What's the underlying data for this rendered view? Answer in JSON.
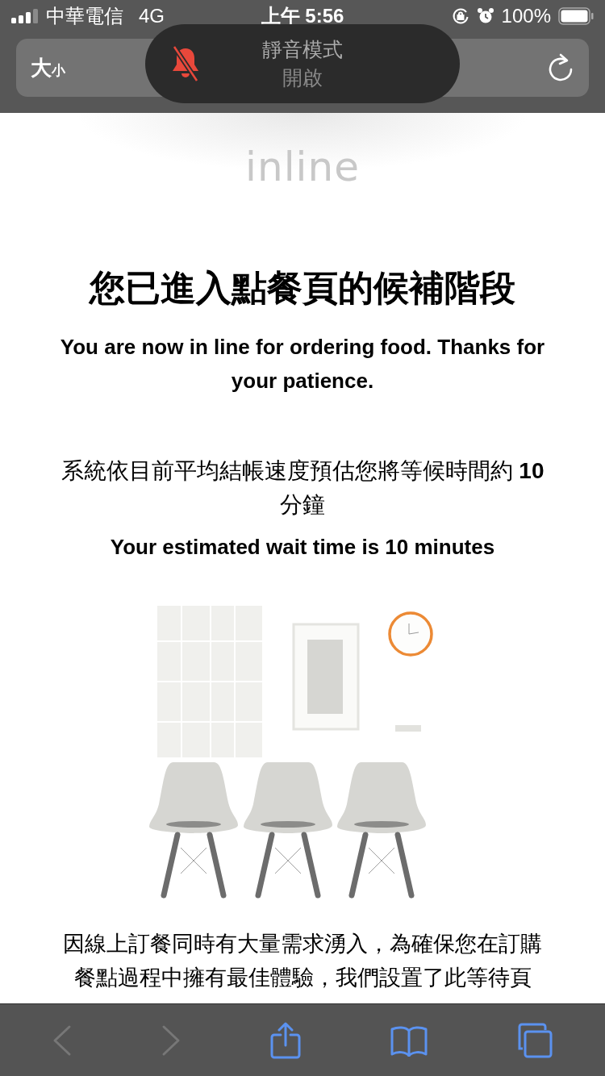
{
  "status_bar": {
    "carrier": "中華電信",
    "network": "4G",
    "time": "上午 5:56",
    "battery": "100%"
  },
  "address_bar": {
    "text_size": {
      "large": "大",
      "small": "小"
    }
  },
  "silent_hud": {
    "title": "靜音模式",
    "state": "開啟"
  },
  "page": {
    "logo": "inline",
    "heading": "您已進入點餐頁的候補階段",
    "subheading": "You are now in line for ordering food. Thanks for your patience.",
    "estimate": "系統依目前平均結帳速度預估您將等候時間約 **10** 分鐘",
    "estimate_en": "Your estimated wait time is 10 minutes",
    "notice": "因線上訂餐同時有大量需求湧入，為確保您在訂購餐點過程中擁有最佳體驗，我們設置了此等待頁"
  },
  "toolbar": {
    "back_disabled": true,
    "forward_disabled": true
  }
}
